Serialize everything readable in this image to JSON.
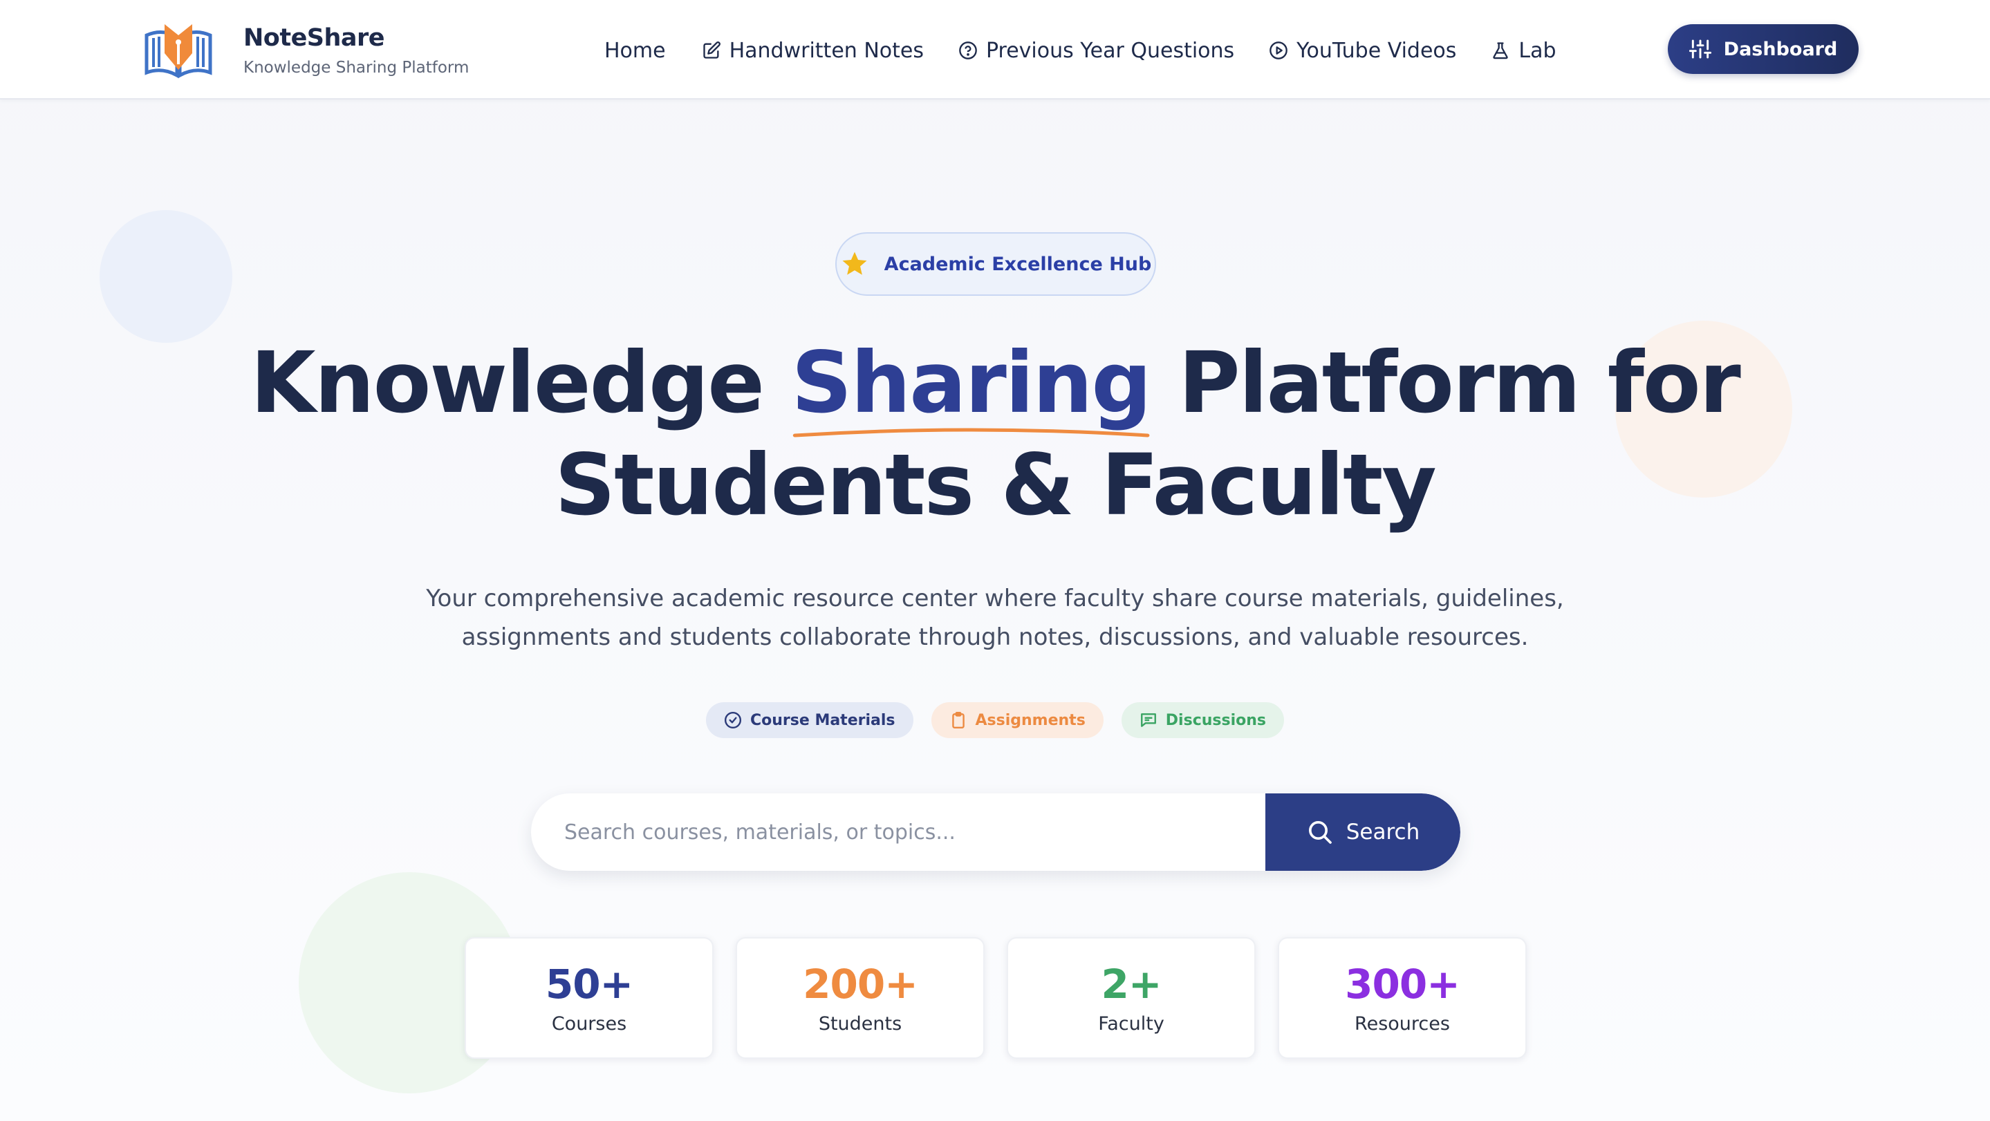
{
  "brand": {
    "name": "NoteShare",
    "tagline": "Knowledge Sharing Platform"
  },
  "nav": {
    "items": [
      {
        "label": "Home",
        "icon": "none"
      },
      {
        "label": "Handwritten Notes",
        "icon": "edit-icon"
      },
      {
        "label": "Previous Year Questions",
        "icon": "question-circle-icon"
      },
      {
        "label": "YouTube Videos",
        "icon": "play-circle-icon"
      },
      {
        "label": "Lab",
        "icon": "flask-icon"
      }
    ],
    "dashboard_label": "Dashboard"
  },
  "hero": {
    "badge": "Academic Excellence Hub",
    "title_part1": "Knowledge ",
    "title_accent": "Sharing",
    "title_part2": " Platform for",
    "title_line2": "Students & Faculty",
    "description": "Your comprehensive academic resource center where faculty share course materials, guidelines, assignments and students collaborate through notes, discussions, and valuable resources.",
    "pills": [
      {
        "label": "Course Materials",
        "icon": "check-circle-icon"
      },
      {
        "label": "Assignments",
        "icon": "clipboard-icon"
      },
      {
        "label": "Discussions",
        "icon": "message-icon"
      }
    ]
  },
  "search": {
    "placeholder": "Search courses, materials, or topics...",
    "value": "",
    "button_label": "Search"
  },
  "stats": [
    {
      "value": "50+",
      "label": "Courses",
      "color": "#2e3f94"
    },
    {
      "value": "200+",
      "label": "Students",
      "color": "#ef8b40"
    },
    {
      "value": "2+",
      "label": "Faculty",
      "color": "#3ea566"
    },
    {
      "value": "300+",
      "label": "Resources",
      "color": "#8b2fe0"
    }
  ],
  "colors": {
    "primary": "#2c3e86",
    "accent_orange": "#ef8b40",
    "accent_green": "#3ea566",
    "accent_purple": "#8b2fe0",
    "text_dark": "#1e2a4a"
  }
}
